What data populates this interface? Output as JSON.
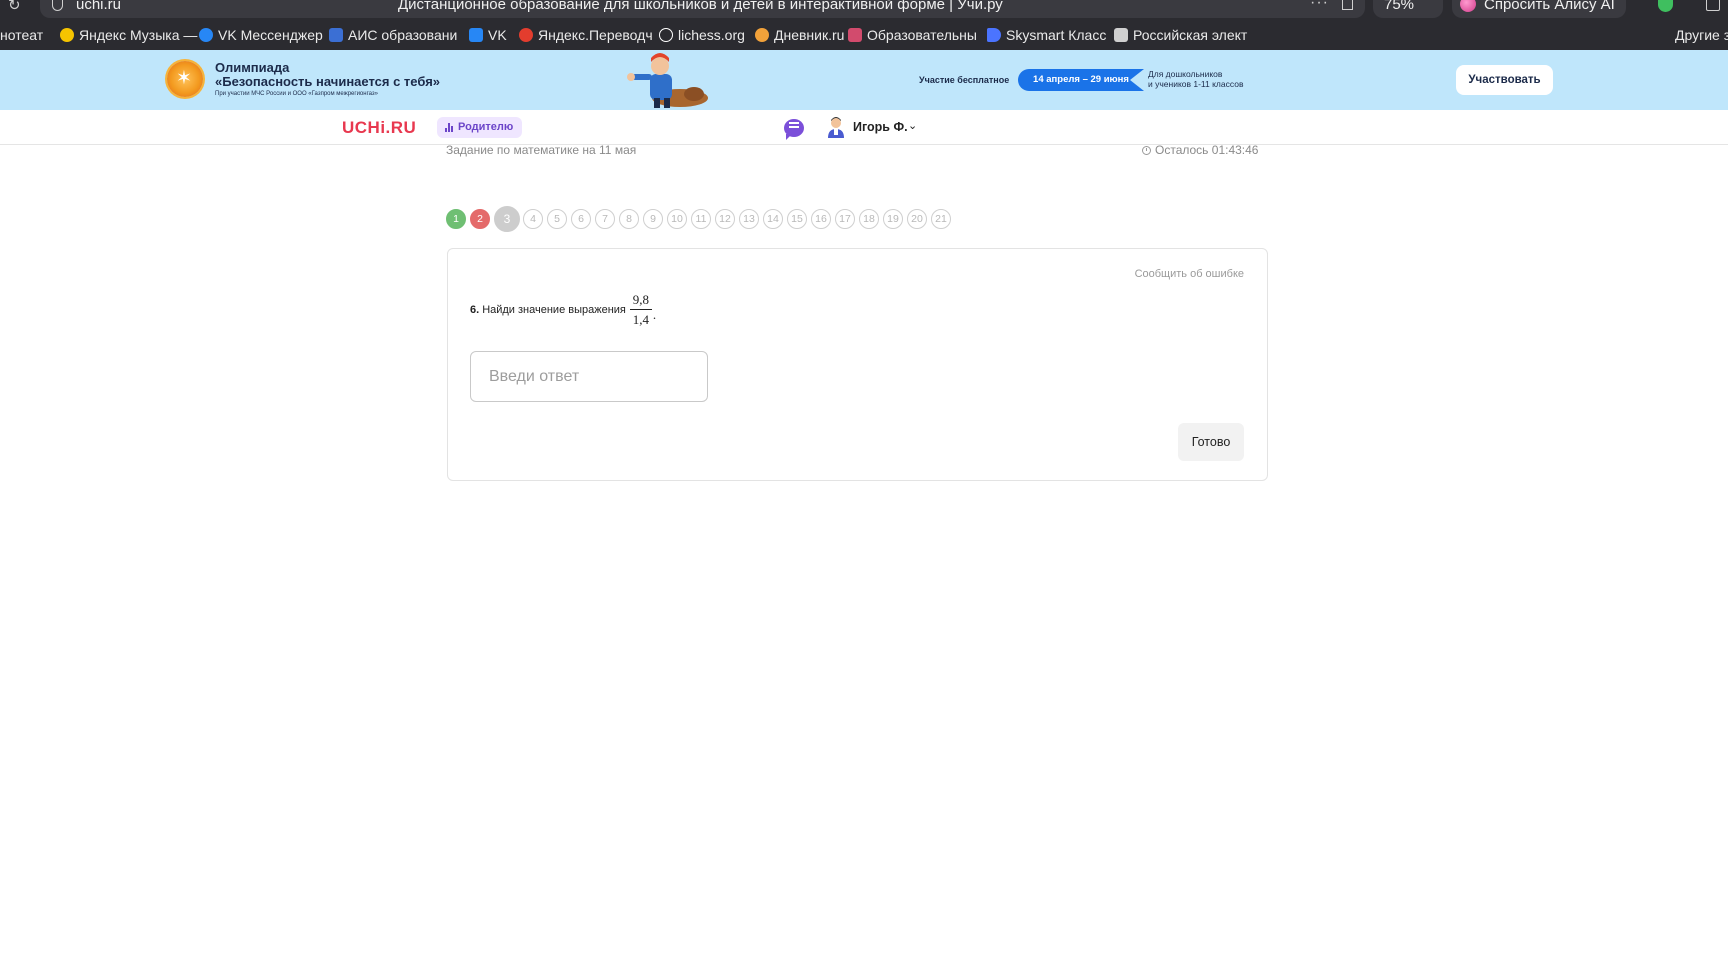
{
  "browser": {
    "url": "uchi.ru",
    "page_title": "Дистанционное образование для школьников и детей в интерактивной форме | Учи.ру",
    "zoom": "75%",
    "alice_label": "Спросить Алису AI",
    "bookmarks": [
      {
        "label": "нотеат",
        "color": "#666666"
      },
      {
        "label": "Яндекс Музыка —",
        "color": "#f5c400"
      },
      {
        "label": "VK Мессенджер",
        "color": "#2787f5"
      },
      {
        "label": "АИС образовани",
        "color": "#3b6fd4"
      },
      {
        "label": "VK",
        "color": "#2787f5"
      },
      {
        "label": "Яндекс.Переводч",
        "color": "#e33d2e"
      },
      {
        "label": "lichess.org",
        "color": "#ffffff"
      },
      {
        "label": "Дневник.ru",
        "color": "#f2a23a"
      },
      {
        "label": "Образовательны",
        "color": "#d24b6d"
      },
      {
        "label": "Skysmart Класс",
        "color": "#4b74ff"
      },
      {
        "label": "Российская элект",
        "color": "#d0d0d0"
      }
    ],
    "other_bookmarks": "Другие з"
  },
  "banner": {
    "title_line1": "Олимпиада",
    "title_line2": "«Безопасность начинается с тебя»",
    "subtitle": "При участии МЧС России и ООО «Газпром межрегионгаз»",
    "free_label": "Участие бесплатное",
    "dates": "14 апреля – 29 июня",
    "audience_line1": "Для дошкольников",
    "audience_line2": "и учеников 1-11 классов",
    "cta": "Участвовать"
  },
  "header": {
    "logo": "UCHi.RU",
    "parent_label": "Родителю",
    "user_name": "Игорь Ф."
  },
  "task": {
    "date_label": "Задание по математике на 11 мая",
    "timer": "Осталось 01:43:46",
    "steps": [
      {
        "n": "1",
        "state": "done"
      },
      {
        "n": "2",
        "state": "wrong"
      },
      {
        "n": "3",
        "state": "current"
      },
      {
        "n": "4",
        "state": "todo"
      },
      {
        "n": "5",
        "state": "todo"
      },
      {
        "n": "6",
        "state": "todo"
      },
      {
        "n": "7",
        "state": "todo"
      },
      {
        "n": "8",
        "state": "todo"
      },
      {
        "n": "9",
        "state": "todo"
      },
      {
        "n": "10",
        "state": "todo"
      },
      {
        "n": "11",
        "state": "todo"
      },
      {
        "n": "12",
        "state": "todo"
      },
      {
        "n": "13",
        "state": "todo"
      },
      {
        "n": "14",
        "state": "todo"
      },
      {
        "n": "15",
        "state": "todo"
      },
      {
        "n": "16",
        "state": "todo"
      },
      {
        "n": "17",
        "state": "todo"
      },
      {
        "n": "18",
        "state": "todo"
      },
      {
        "n": "19",
        "state": "todo"
      },
      {
        "n": "20",
        "state": "todo"
      },
      {
        "n": "21",
        "state": "todo"
      }
    ],
    "report_label": "Сообщить об ошибке",
    "question_number": "6.",
    "question_text": "Найди значение выражения",
    "numerator": "9,8",
    "denominator": "1,4",
    "question_end": ".",
    "answer_placeholder": "Введи ответ",
    "answer_value": "",
    "submit_label": "Готово"
  }
}
